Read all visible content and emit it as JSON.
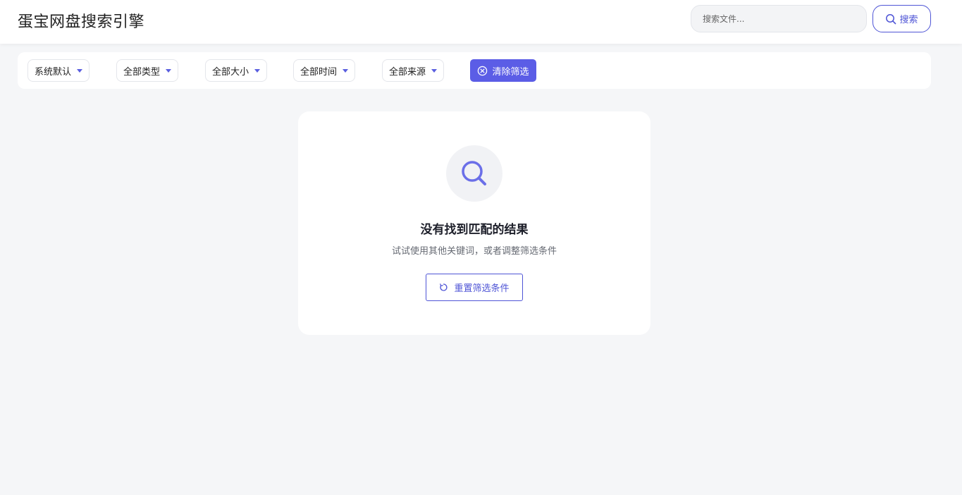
{
  "header": {
    "title": "蛋宝网盘搜索引擎",
    "search_placeholder": "搜索文件...",
    "search_button_label": "搜索"
  },
  "filters": {
    "sort_label": "系统默认",
    "type_label": "全部类型",
    "size_label": "全部大小",
    "time_label": "全部时间",
    "source_label": "全部来源",
    "clear_label": "清除筛选"
  },
  "empty_state": {
    "title": "没有找到匹配的结果",
    "subtitle": "试试使用其他关键词，或者调整筛选条件",
    "reset_label": "重置筛选条件"
  },
  "icons": {
    "search": "search-icon",
    "clear": "circle-x-icon",
    "empty": "magnifier-icon",
    "reset": "refresh-icon",
    "caret": "chevron-down-icon"
  },
  "colors": {
    "accent": "#5b5de6",
    "page_bg": "#f5f6f8",
    "card_bg": "#ffffff"
  }
}
